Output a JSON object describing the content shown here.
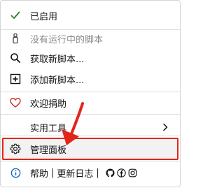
{
  "menu": {
    "items": [
      {
        "label": "已启用",
        "icon": "check-icon",
        "color": "#2e7d32"
      },
      {
        "label": "没有运行中的脚本",
        "icon": "tampermonkey-icon",
        "disabled": true
      },
      {
        "label": "获取新脚本...",
        "icon": "search-icon"
      },
      {
        "label": "添加新脚本...",
        "icon": "plus-box-icon"
      },
      {
        "label": "欢迎捐助",
        "icon": "heart-icon",
        "color": "#d32f2f"
      },
      {
        "label": "实用工具",
        "icon": "chevron-right-icon",
        "submenu": true
      },
      {
        "label": "管理面板",
        "icon": "gear-icon",
        "highlighted": true
      }
    ],
    "footer": {
      "help_label": "帮助",
      "separator": "|",
      "changelog_label": "更新日志",
      "separator2": "|",
      "social_icons": [
        "github-icon",
        "facebook-icon",
        "instagram-icon"
      ]
    }
  },
  "annotation": {
    "color": "#e1251b"
  }
}
